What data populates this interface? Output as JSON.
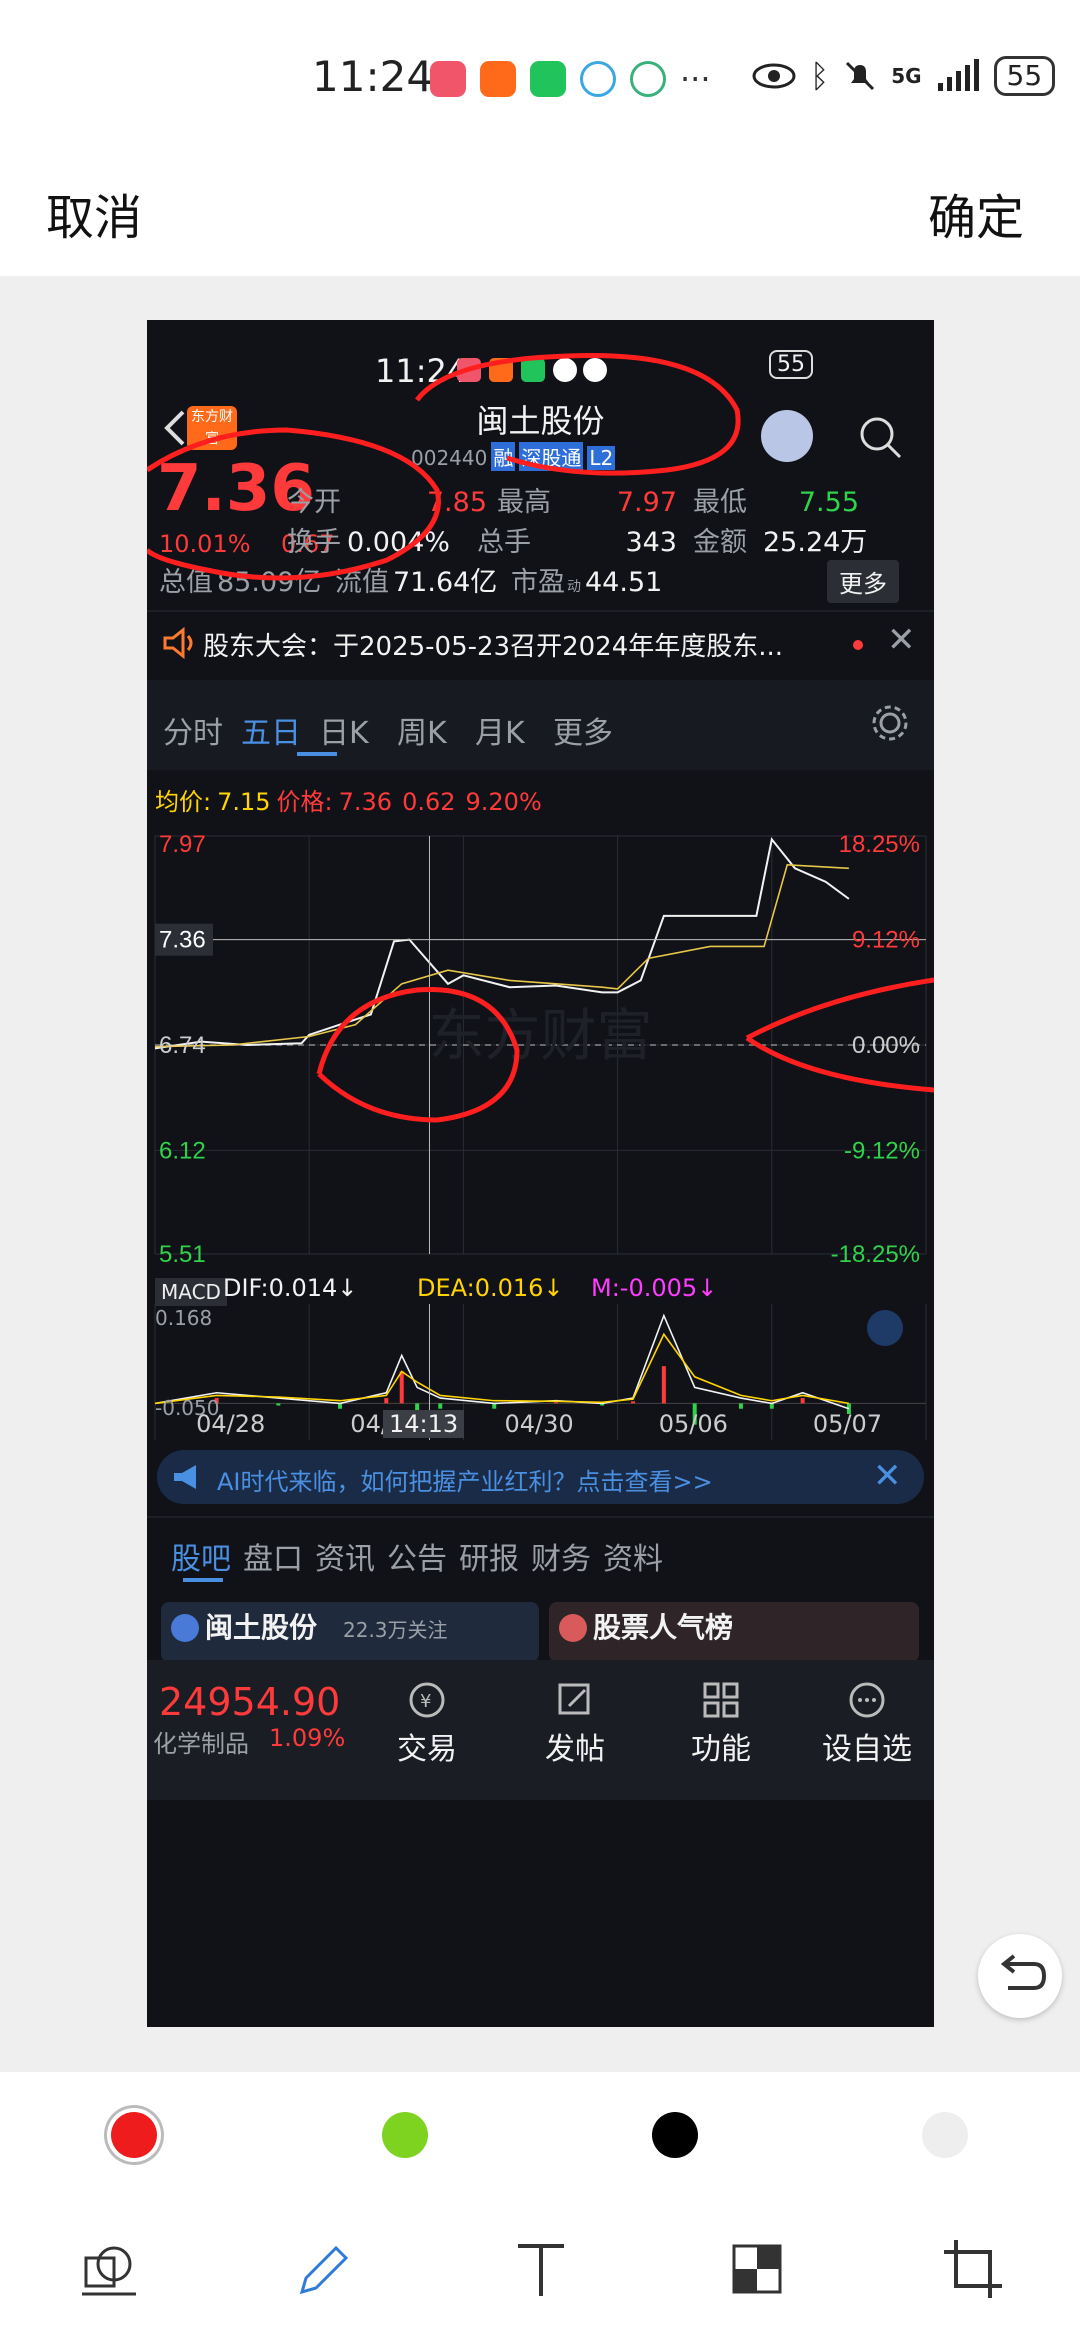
{
  "status_bar": {
    "time": "11:24",
    "battery": "55",
    "net": "5G"
  },
  "editor": {
    "cancel_label": "取消",
    "confirm_label": "确定"
  },
  "app": {
    "status_time": "11:24",
    "status_battery": "55",
    "stock_name": "闽土股份",
    "stock_code": "002440",
    "code_tags": [
      "融",
      "深股通",
      "L2"
    ],
    "logo_text": "东方财富",
    "price": "7.36",
    "change_pct": "10.01%",
    "change_amt": "0.67",
    "stats": {
      "open_label": "今开",
      "open": "7.85",
      "high_label": "最高",
      "high": "7.97",
      "low_label": "最低",
      "low": "7.55",
      "turnover_label": "换手",
      "turnover": "0.004%",
      "volume_label": "总手",
      "volume": "343",
      "amount_label": "金额",
      "amount": "25.24万",
      "mktcap_label": "总值",
      "mktcap": "85.09亿",
      "float_label": "流值",
      "float": "71.64亿",
      "pe_label": "市盈",
      "pe_sup": "动",
      "pe": "44.51",
      "more_label": "更多"
    },
    "notice": "股东大会：于2025-05-23召开2024年年度股东...",
    "chart_tabs": [
      "分时",
      "五日",
      "日K",
      "周K",
      "月K",
      "更多"
    ],
    "active_chart_tab": "五日",
    "legend": {
      "avg_label": "均价:",
      "avg": "7.15",
      "price_label": "价格:",
      "price": "7.36",
      "chg": "0.62",
      "pct": "9.20%"
    },
    "cursor_price": "7.36",
    "cursor_time": "14:13",
    "watermark": "东方财富",
    "macd": {
      "label": "MACD",
      "dif": "DIF:0.014↓",
      "dea": "DEA:0.016↓",
      "m": "M:-0.005↓",
      "top": "0.168",
      "bottom": "-0.050"
    },
    "ad_text": "AI时代来临，如何把握产业红利？点击查看>>",
    "bottom_tabs": [
      "股吧",
      "盘口",
      "资讯",
      "公告",
      "研报",
      "财务",
      "资料"
    ],
    "active_bottom_tab": "股吧",
    "card1": {
      "title": "闽土股份",
      "sub": "22.3万关注"
    },
    "card2": {
      "title": "股票人气榜"
    },
    "index_value": "24954.90",
    "index_name": "化学制品",
    "index_pct": "1.09%",
    "bottom_actions": [
      "交易",
      "发帖",
      "功能",
      "设自选"
    ]
  },
  "chart_data": {
    "type": "line",
    "title": "",
    "x_labels": [
      "04/28",
      "04/29",
      "04/30",
      "05/06",
      "05/07"
    ],
    "y_left_ticks": [
      "7.97",
      "7.36",
      "6.74",
      "6.12",
      "5.51"
    ],
    "y_right_ticks": [
      "18.25%",
      "9.12%",
      "0.00%",
      "-9.12%",
      "-18.25%"
    ],
    "ylim": [
      5.51,
      7.97
    ],
    "prev_close": 6.74,
    "series": [
      {
        "name": "价格",
        "color": "#f2f2f2",
        "x": [
          0,
          0.3,
          0.6,
          0.95,
          1.0,
          1.2,
          1.4,
          1.55,
          1.65,
          1.9,
          2.0,
          2.3,
          2.6,
          2.9,
          3.0,
          3.15,
          3.3,
          3.6,
          3.9,
          4.0,
          4.15,
          4.35,
          4.5
        ],
        "y": [
          6.72,
          6.76,
          6.74,
          6.75,
          6.8,
          6.86,
          6.92,
          7.35,
          7.36,
          7.1,
          7.15,
          7.08,
          7.09,
          7.05,
          7.05,
          7.12,
          7.5,
          7.5,
          7.5,
          7.95,
          7.78,
          7.7,
          7.6
        ]
      },
      {
        "name": "均价",
        "color": "#e8c64a",
        "x": [
          0,
          0.5,
          1.0,
          1.3,
          1.6,
          1.9,
          2.3,
          2.9,
          3.0,
          3.2,
          3.6,
          3.95,
          4.1,
          4.5
        ],
        "y": [
          6.73,
          6.74,
          6.79,
          6.86,
          7.1,
          7.18,
          7.12,
          7.08,
          7.07,
          7.25,
          7.32,
          7.32,
          7.8,
          7.78
        ]
      }
    ],
    "macd": {
      "ylim": [
        -0.05,
        0.168
      ],
      "dif_color": "#f2f2f2",
      "dea_color": "#ffd400",
      "x": [
        0,
        0.4,
        0.8,
        1.2,
        1.5,
        1.6,
        1.7,
        1.85,
        2.2,
        2.6,
        2.9,
        3.1,
        3.3,
        3.5,
        3.8,
        4.0,
        4.2,
        4.5
      ],
      "dif": [
        0.0,
        0.02,
        0.01,
        0.0,
        0.02,
        0.09,
        0.03,
        0.01,
        0.0,
        0.005,
        0.0,
        0.01,
        0.165,
        0.03,
        0.01,
        0.0,
        0.02,
        -0.01
      ],
      "dea": [
        0.0,
        0.015,
        0.012,
        0.005,
        0.015,
        0.06,
        0.04,
        0.015,
        0.005,
        0.004,
        0.002,
        0.008,
        0.13,
        0.05,
        0.015,
        0.005,
        0.015,
        0.0
      ]
    }
  },
  "palette": {
    "colors": [
      "#ee1c1c",
      "#7ed321",
      "#000000",
      "#eeeeee"
    ],
    "selected": 0
  },
  "tools": [
    "shapes-icon",
    "pen-icon",
    "text-icon",
    "mosaic-icon",
    "crop-icon"
  ]
}
